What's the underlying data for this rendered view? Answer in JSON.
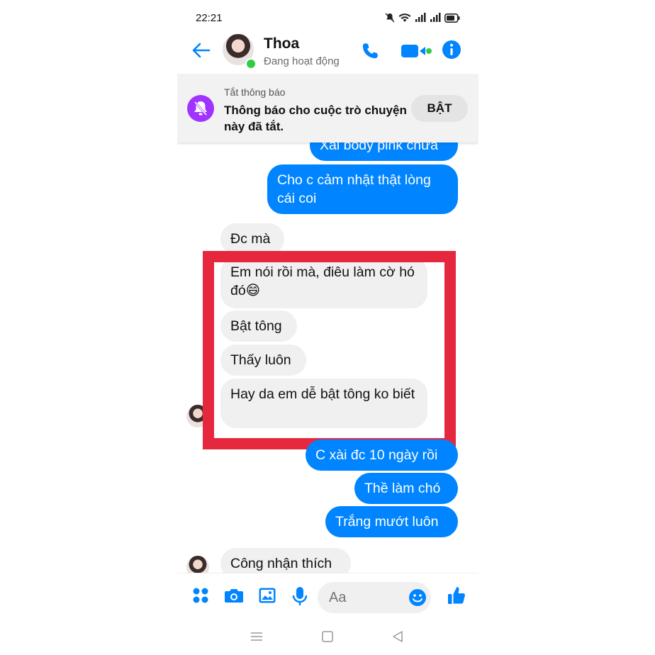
{
  "status_bar": {
    "time": "22:21"
  },
  "header": {
    "contact_name": "Thoa",
    "presence": "Đang hoạt động"
  },
  "mute_banner": {
    "title": "Tắt thông báo",
    "text": "Thông báo cho cuộc trò chuyện này đã tắt.",
    "button": "BẬT"
  },
  "messages": [
    {
      "from": "me",
      "text": "Xài body pink chưa"
    },
    {
      "from": "me",
      "text": "Cho c cảm nhật thật lòng cái coi"
    },
    {
      "from": "them",
      "text": "Đc mà"
    },
    {
      "from": "them",
      "text": "Em nói rồi mà, điêu làm cờ hó đó😄"
    },
    {
      "from": "them",
      "text": "Bật tông"
    },
    {
      "from": "them",
      "text": "Thấy luôn"
    },
    {
      "from": "them",
      "text": "Hay da em dễ bật tông ko biết"
    },
    {
      "from": "me",
      "text": "C xài đc 10 ngày rồi"
    },
    {
      "from": "me",
      "text": "Thề làm chó"
    },
    {
      "from": "me",
      "text": "Trắng mướt luôn"
    },
    {
      "from": "them",
      "text": "Công nhận thích"
    }
  ],
  "composer": {
    "placeholder": "Aa"
  },
  "colors": {
    "accent": "#0084ff",
    "highlight_box": "#e6283f",
    "mute_icon_bg": "#a033ff",
    "online": "#31cc46"
  }
}
